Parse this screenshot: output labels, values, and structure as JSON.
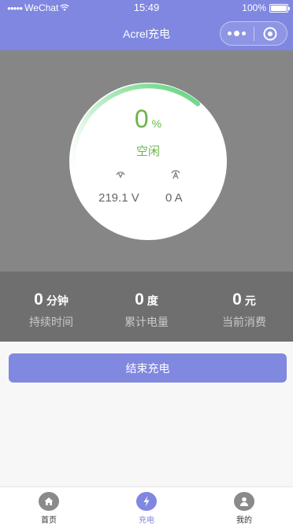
{
  "status_bar": {
    "carrier": "WeChat",
    "signal_dots": "●●●●●",
    "time": "15:49",
    "battery": "100%",
    "battery_level": 1.0
  },
  "header": {
    "title": "Acrel充电",
    "more_icon": "more-dots-icon",
    "close_icon": "target-circle-icon"
  },
  "gauge": {
    "percent_value": "0",
    "percent_unit": "%",
    "progress": 0,
    "state": "空闲",
    "voltage": "219.1 V",
    "current": "0 A",
    "colors": {
      "arc_start": "#5fd37b",
      "arc_fade": "#e6f5e6",
      "text": "#6ab449"
    }
  },
  "stats": [
    {
      "value": "0",
      "unit": "分钟",
      "label": "持续时间"
    },
    {
      "value": "0",
      "unit": "度",
      "label": "累计电量"
    },
    {
      "value": "0",
      "unit": "元",
      "label": "当前消费"
    }
  ],
  "actions": {
    "end_label": "结束充电"
  },
  "tabbar": {
    "items": [
      {
        "label": "首页",
        "icon": "home-icon",
        "active": false
      },
      {
        "label": "充电",
        "icon": "lightning-icon",
        "active": true
      },
      {
        "label": "我的",
        "icon": "user-icon",
        "active": false
      }
    ]
  },
  "colors": {
    "accent": "#7f87e1",
    "gauge_bg": "#868686",
    "stats_bg": "#6f6f6f"
  }
}
